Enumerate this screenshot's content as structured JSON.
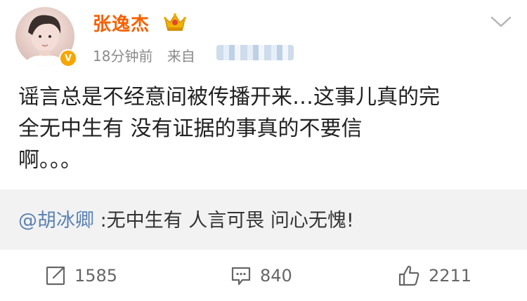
{
  "post": {
    "author": "张逸杰",
    "time_ago": "18分钟前",
    "source_label": "来自",
    "text_lines": [
      "谣言总是不经意间被传播开来…这事儿真的完",
      "全无中生有 没有证据的事真的不要信",
      "啊。。。"
    ]
  },
  "quote": {
    "mention": "@胡冰卿",
    "text": " :无中生有 人言可畏 问心无愧!"
  },
  "actions": {
    "repost_count": "1585",
    "comment_count": "840",
    "like_count": "2211"
  },
  "colors": {
    "username": "#f56100",
    "mention": "#5b82b3",
    "meta": "#8a8a8a",
    "quote_bg": "#f2f2f2",
    "badge": "#f7a600"
  },
  "icons": {
    "badge": "verified-v-icon",
    "membership": "crown-icon",
    "menu": "chevron-down-icon",
    "repost": "repost-icon",
    "comment": "comment-icon",
    "like": "thumbs-up-icon"
  }
}
